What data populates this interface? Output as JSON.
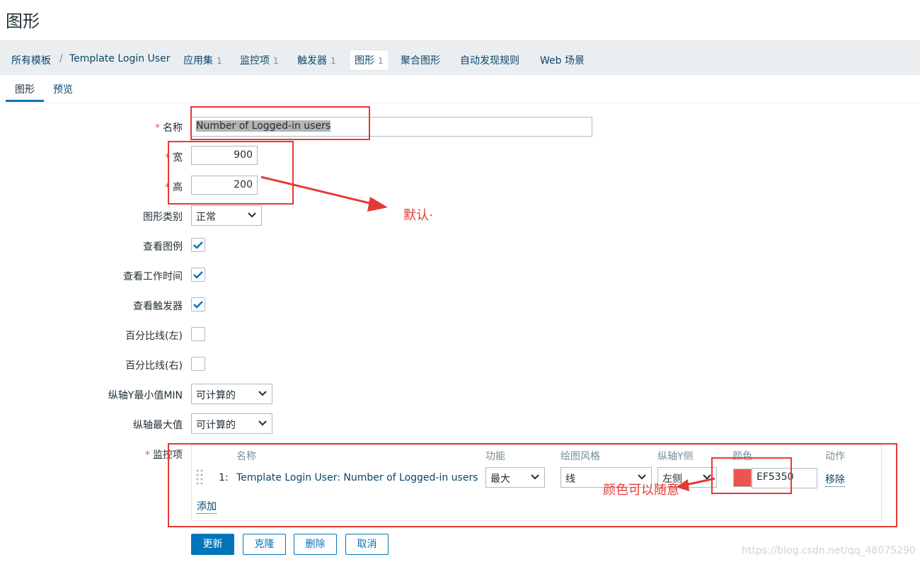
{
  "page": {
    "title": "图形"
  },
  "breadcrumb": {
    "all_templates": "所有模板",
    "separator": "/",
    "template": "Template Login User",
    "tabs": [
      {
        "label": "应用集",
        "count": "1"
      },
      {
        "label": "监控项",
        "count": "1"
      },
      {
        "label": "触发器",
        "count": "1"
      },
      {
        "label": "图形",
        "count": "1"
      },
      {
        "label": "聚合图形",
        "count": ""
      },
      {
        "label": "自动发现规则",
        "count": ""
      },
      {
        "label": "Web 场景",
        "count": ""
      }
    ]
  },
  "subtabs": [
    {
      "label": "图形"
    },
    {
      "label": "预览"
    }
  ],
  "form": {
    "required_mark": "*",
    "name_label": "名称",
    "name_value": "Number of Logged-in users",
    "width_label": "宽",
    "width_value": "900",
    "height_label": "高",
    "height_value": "200",
    "graph_type_label": "图形类别",
    "graph_type_value": "正常",
    "show_legend_label": "查看图例",
    "show_legend_checked": true,
    "show_working_time_label": "查看工作时间",
    "show_working_time_checked": true,
    "show_triggers_label": "查看触发器",
    "show_triggers_checked": true,
    "percentile_left_label": "百分比线(左)",
    "percentile_left_checked": false,
    "percentile_right_label": "百分比线(右)",
    "percentile_right_checked": false,
    "ymin_label": "纵轴Y最小值MIN",
    "ymin_value": "可计算的",
    "ymax_label": "纵轴最大值",
    "ymax_value": "可计算的",
    "items_label": "监控项"
  },
  "items_table": {
    "headers": {
      "name": "名称",
      "function": "功能",
      "draw_style": "绘图风格",
      "y_axis_side": "纵轴Y侧",
      "color": "颜色",
      "action": "动作"
    },
    "rows": [
      {
        "index": "1:",
        "name": "Template Login User: Number of Logged-in users",
        "function": "最大",
        "draw_style": "线",
        "y_axis_side": "左侧",
        "color_hex": "EF5350",
        "color_value": "EF5350",
        "remove": "移除"
      }
    ],
    "add": "添加"
  },
  "buttons": {
    "update": "更新",
    "clone": "克隆",
    "delete": "删除",
    "cancel": "取消"
  },
  "annotations": {
    "default_note": "默认·",
    "color_note": "颜色可以随意"
  },
  "watermark": "https://blog.csdn.net/qq_48075290",
  "colors": {
    "accent": "#0275b8",
    "link": "#0a466a",
    "annotation": "#e53935",
    "swatch": "#EF5350"
  }
}
